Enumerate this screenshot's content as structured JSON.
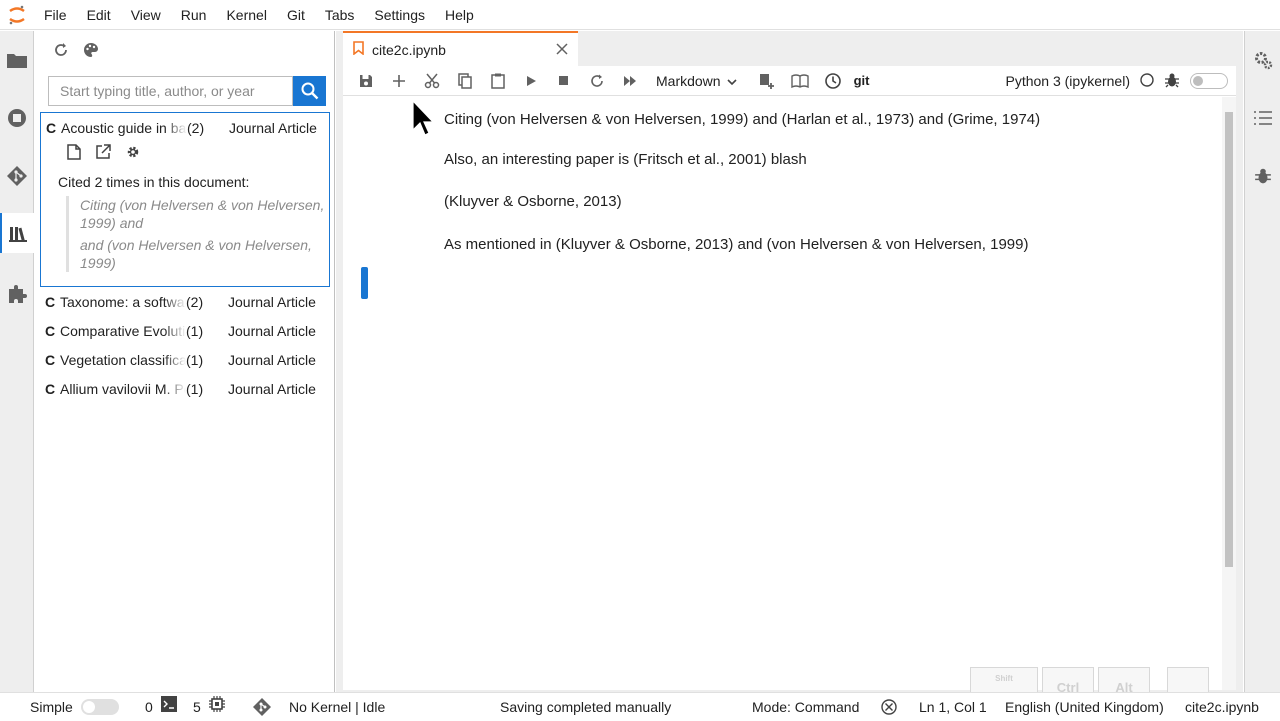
{
  "menu": [
    "File",
    "Edit",
    "View",
    "Run",
    "Kernel",
    "Git",
    "Tabs",
    "Settings",
    "Help"
  ],
  "citations_panel": {
    "search_placeholder": "Start typing title, author, or year",
    "items": [
      {
        "marker": "C",
        "title": "Acoustic guide in bat",
        "count": "(2)",
        "type": "Journal Article"
      },
      {
        "marker": "C",
        "title": "Taxonome: a software",
        "count": "(2)",
        "type": "Journal Article"
      },
      {
        "marker": "C",
        "title": "Comparative Evolution",
        "count": "(1)",
        "type": "Journal Article"
      },
      {
        "marker": "C",
        "title": "Vegetation classification",
        "count": "(1)",
        "type": "Journal Article"
      },
      {
        "marker": "C",
        "title": "Allium vavilovii M. Pop",
        "count": "(1)",
        "type": "Journal Article"
      }
    ],
    "cited_label": "Cited 2 times in this document:",
    "quotes": [
      "Citing (von Helversen & von Helversen, 1999) and",
      "and (von Helversen & von Helversen, 1999)"
    ]
  },
  "tab": {
    "label": "cite2c.ipynb"
  },
  "toolbar": {
    "cell_type": "Markdown",
    "git_label": "git",
    "kernel_name": "Python 3 (ipykernel)"
  },
  "cells": [
    "Citing (von Helversen & von Helversen, 1999) and (Harlan et al., 1973) and (Grime, 1974)",
    "Also, an interesting paper is (Fritsch et al., 2001) blash",
    "(Kluyver & Osborne, 2013)",
    "As mentioned in (Kluyver & Osborne, 2013) and (von Helversen & von Helversen, 1999)"
  ],
  "keys": [
    "Shift",
    "Ctrl",
    "Alt"
  ],
  "status": {
    "simple_label": "Simple",
    "terminals": "0",
    "kernels": "5",
    "kernel_status": "No Kernel | Idle",
    "save_msg": "Saving completed manually",
    "mode": "Mode: Command",
    "position": "Ln 1, Col 1",
    "language": "English (United Kingdom)",
    "filename": "cite2c.ipynb"
  },
  "colors": {
    "accent": "#1976d2",
    "brand": "#f37726"
  }
}
